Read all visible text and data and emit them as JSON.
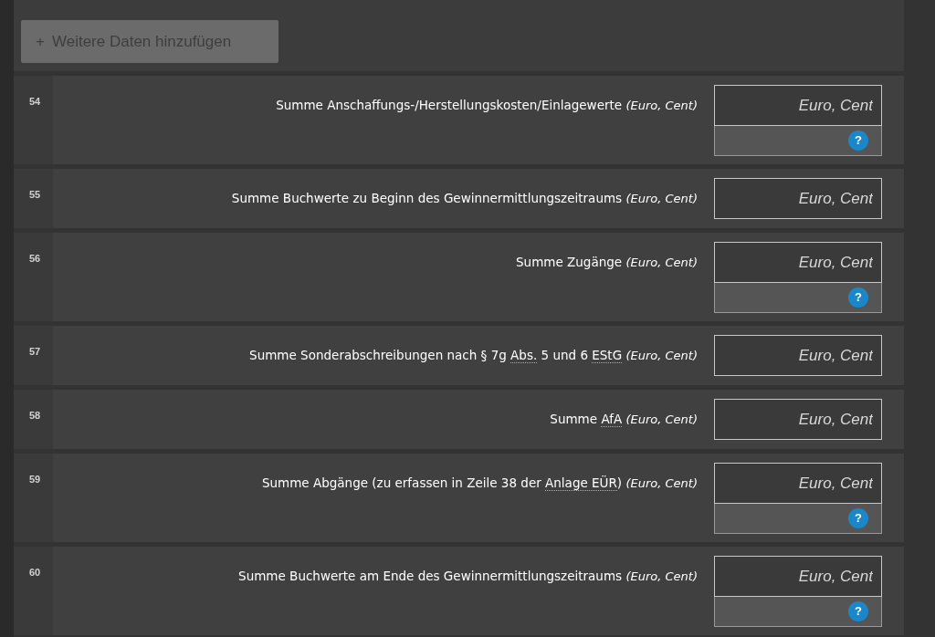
{
  "add_button": {
    "icon": "+",
    "label": "Weitere Daten hinzufügen",
    "disabled": true
  },
  "rows": [
    {
      "number": "54",
      "label": [
        {
          "kind": "text",
          "text": "Summe Anschaffungs-/Herstellungskosten/Einlagewerte"
        }
      ],
      "unit": "(Euro, Cent)",
      "placeholder": "Euro, Cent",
      "help": "?"
    },
    {
      "number": "55",
      "label": [
        {
          "kind": "text",
          "text": "Summe Buchwerte zu Beginn des Gewinnermittlungszeitraums"
        }
      ],
      "unit": "(Euro, Cent)",
      "placeholder": "Euro, Cent"
    },
    {
      "number": "56",
      "label": [
        {
          "kind": "text",
          "text": "Summe Zugänge"
        }
      ],
      "unit": "(Euro, Cent)",
      "placeholder": "Euro, Cent",
      "help": "?"
    },
    {
      "number": "57",
      "label": [
        {
          "kind": "text",
          "text": "Summe Sonderabschreibungen nach § 7g "
        },
        {
          "kind": "abbr",
          "text": "Abs."
        },
        {
          "kind": "text",
          "text": " 5 und 6 "
        },
        {
          "kind": "abbr",
          "text": "EStG"
        }
      ],
      "unit": "(Euro, Cent)",
      "placeholder": "Euro, Cent"
    },
    {
      "number": "58",
      "label": [
        {
          "kind": "text",
          "text": "Summe "
        },
        {
          "kind": "abbr",
          "text": "AfA"
        }
      ],
      "unit": "(Euro, Cent)",
      "placeholder": "Euro, Cent"
    },
    {
      "number": "59",
      "label": [
        {
          "kind": "text",
          "text": "Summe Abgänge (zu erfassen in Zeile 38 der "
        },
        {
          "kind": "abbr",
          "text": "Anlage EÜR"
        },
        {
          "kind": "text",
          "text": ")"
        }
      ],
      "unit": "(Euro, Cent)",
      "placeholder": "Euro, Cent",
      "help": "?"
    },
    {
      "number": "60",
      "label": [
        {
          "kind": "text",
          "text": "Summe Buchwerte am Ende des Gewinnermittlungszeitraums"
        }
      ],
      "unit": "(Euro, Cent)",
      "placeholder": "Euro, Cent",
      "help": "?"
    }
  ]
}
